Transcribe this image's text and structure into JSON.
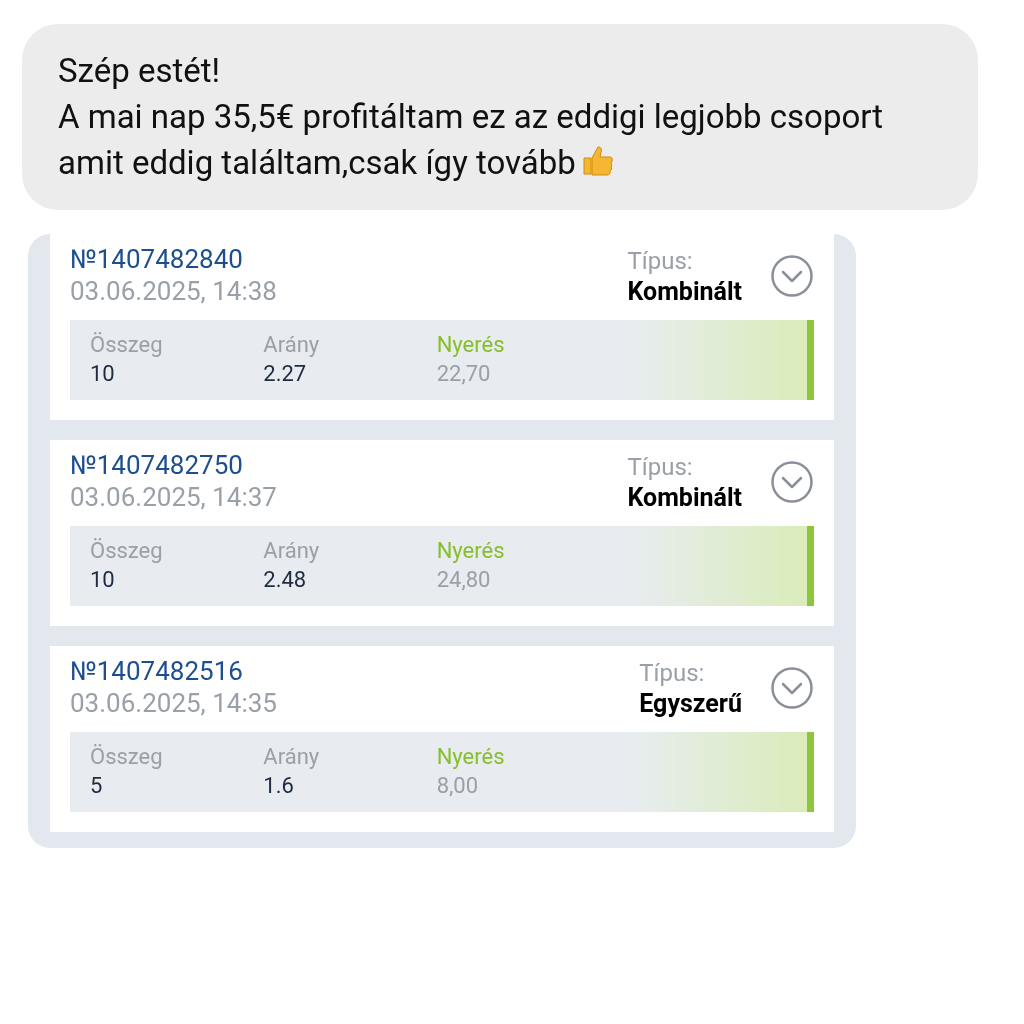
{
  "message": {
    "lines": [
      "Szép estét!",
      "A mai nap 35,5€ profitáltam ez az eddigi legjobb csoport amit eddig találtam,csak így tovább"
    ]
  },
  "bets": [
    {
      "number": "№1407482840",
      "datetime": "03.06.2025, 14:38",
      "type_label": "Típus:",
      "type": "Kombinált",
      "stake_label": "Összeg",
      "stake": "10",
      "odds_label": "Arány",
      "odds": "2.27",
      "win_label": "Nyerés",
      "win": "22,70"
    },
    {
      "number": "№1407482750",
      "datetime": "03.06.2025, 14:37",
      "type_label": "Típus:",
      "type": "Kombinált",
      "stake_label": "Összeg",
      "stake": "10",
      "odds_label": "Arány",
      "odds": "2.48",
      "win_label": "Nyerés",
      "win": "24,80"
    },
    {
      "number": "№1407482516",
      "datetime": "03.06.2025, 14:35",
      "type_label": "Típus:",
      "type": "Egyszerű",
      "stake_label": "Összeg",
      "stake": "5",
      "odds_label": "Arány",
      "odds": "1.6",
      "win_label": "Nyerés",
      "win": "8,00"
    }
  ]
}
